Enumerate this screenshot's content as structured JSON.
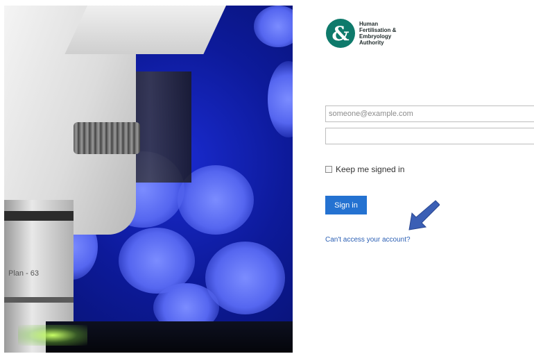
{
  "hero": {
    "objective_text": "Plan - 63"
  },
  "logo": {
    "mark_glyph": "&",
    "org_name": "Human\nFertilisation &\nEmbryology\nAuthority",
    "brand_color": "#0e7a6b"
  },
  "form": {
    "email_placeholder": "someone@example.com",
    "email_value": "",
    "password_value": "",
    "remember_label": "Keep me signed in",
    "remember_checked": false,
    "signin_label": "Sign in",
    "signin_color": "#2472d1",
    "cant_access_label": "Can't access your account?"
  },
  "annotation": {
    "arrow_icon": "arrow-down-left-icon",
    "arrow_color": "#3b5fb5"
  }
}
